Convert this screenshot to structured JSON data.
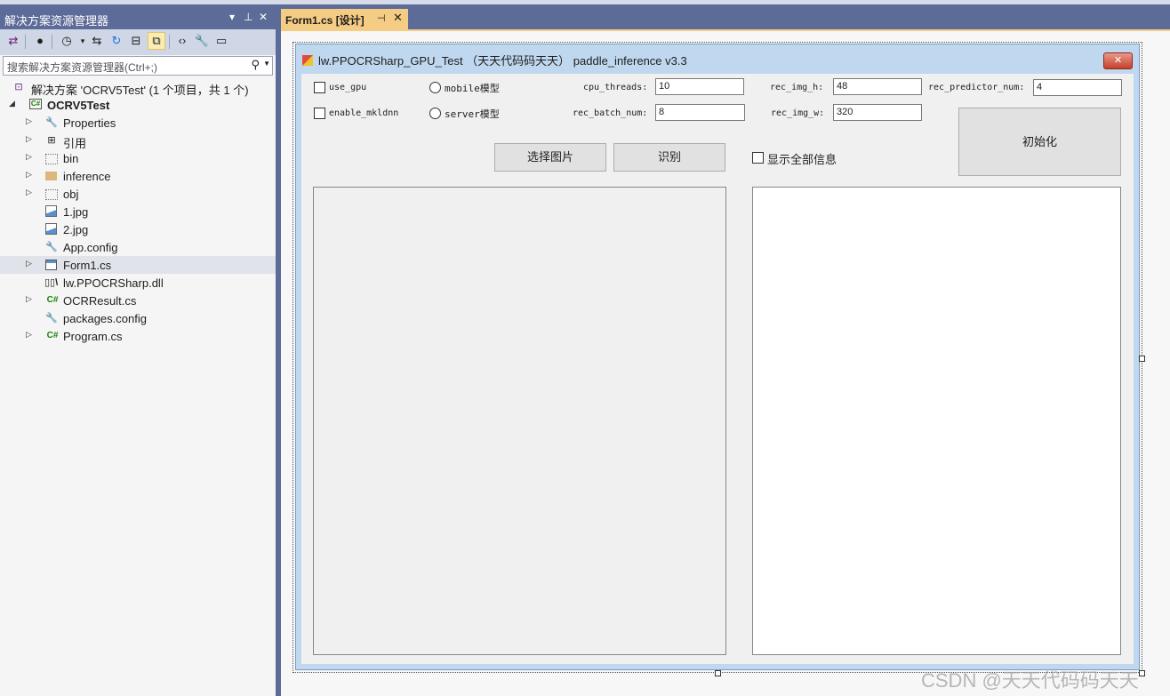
{
  "solution_explorer": {
    "title": "解决方案资源管理器",
    "pin_icon": "⊥",
    "search_placeholder": "搜索解决方案资源管理器(Ctrl+;)",
    "tree": {
      "solution": "解决方案 'OCRV5Test' (1 个项目，共 1 个)",
      "project": "OCRV5Test",
      "items": [
        "Properties",
        "引用",
        "bin",
        "inference",
        "obj",
        "1.jpg",
        "2.jpg",
        "App.config",
        "Form1.cs",
        "lw.PPOCRSharp.dll",
        "OCRResult.cs",
        "packages.config",
        "Program.cs"
      ]
    }
  },
  "tab": {
    "label": "Form1.cs [设计]"
  },
  "form": {
    "caption": "lw.PPOCRSharp_GPU_Test （天天代码码天天） paddle_inference v3.3",
    "use_gpu_label": "use_gpu",
    "enable_mkldnn_label": "enable_mkldnn",
    "mobile_label": "mobile模型",
    "server_label": "server模型",
    "cpu_threads_label": "cpu_threads:",
    "cpu_threads_value": "10",
    "rec_batch_num_label": "rec_batch_num:",
    "rec_batch_num_value": "8",
    "rec_img_h_label": "rec_img_h:",
    "rec_img_h_value": "48",
    "rec_img_w_label": "rec_img_w:",
    "rec_img_w_value": "320",
    "rec_predictor_num_label": "rec_predictor_num:",
    "rec_predictor_num_value": "4",
    "select_image_button": "选择图片",
    "recognize_button": "识别",
    "show_all_label": "显示全部信息",
    "init_button": "初始化"
  },
  "watermark": "CSDN @天天代码码天天"
}
